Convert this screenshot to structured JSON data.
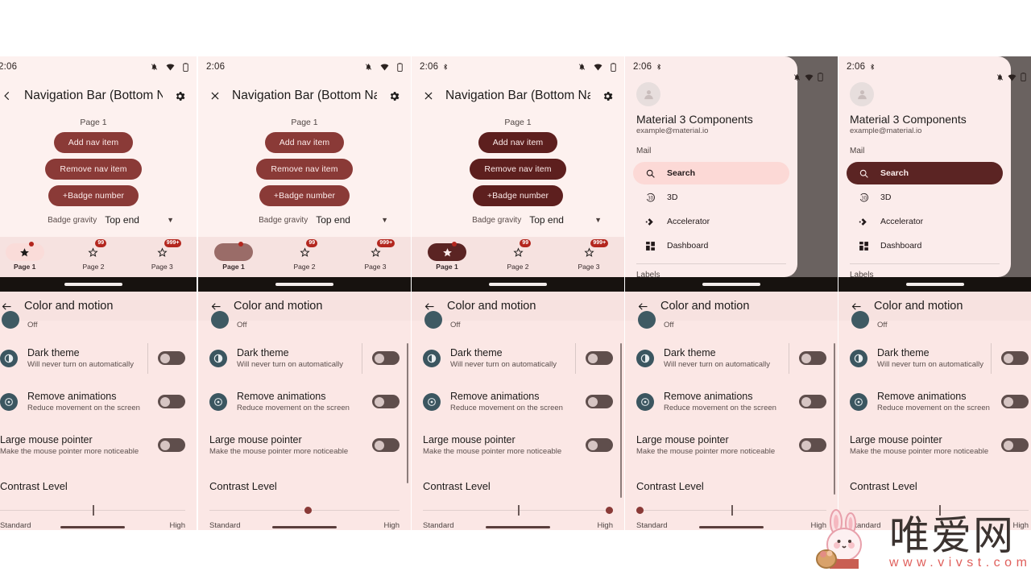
{
  "statusbar": {
    "time": "2:06",
    "time_clipped": "06",
    "icons": [
      "notifications-off-icon",
      "wifi-icon",
      "battery-icon",
      "bluetooth-icon"
    ]
  },
  "demo": {
    "title": "Navigation Bar (Bottom Naviga...",
    "page_label": "Page 1",
    "buttons": [
      {
        "label": "Add nav item"
      },
      {
        "label": "Remove nav item"
      },
      {
        "label": "+Badge number"
      }
    ],
    "gravity_label": "Badge gravity",
    "gravity_value": "Top end",
    "nav_items": [
      {
        "label": "Page 1",
        "badge": "",
        "badge_dot": true
      },
      {
        "label": "Page 2",
        "badge": "99",
        "badge_dot": false
      },
      {
        "label": "Page 3",
        "badge": "999+",
        "badge_dot": false
      }
    ]
  },
  "drawer": {
    "title": "Material 3 Components",
    "email": "example@material.io",
    "section_mail": "Mail",
    "section_labels": "Labels",
    "items": [
      {
        "label": "Search",
        "icon": "search-icon"
      },
      {
        "label": "3D",
        "icon": "threed-icon"
      },
      {
        "label": "Accelerator",
        "icon": "accelerator-icon"
      },
      {
        "label": "Dashboard",
        "icon": "dashboard-icon"
      }
    ]
  },
  "settings": {
    "title": "Color and motion",
    "partial_row_value": "Off",
    "rows": [
      {
        "title": "Dark theme",
        "desc": "Will never turn on automatically",
        "icon": "contrast-icon"
      },
      {
        "title": "Remove animations",
        "desc": "Reduce movement on the screen",
        "icon": "motion-icon"
      },
      {
        "title": "Large mouse pointer",
        "desc": "Make the mouse pointer more noticeable",
        "icon": ""
      }
    ],
    "slider_title": "Contrast Level",
    "slider_min_label": "Standard",
    "slider_max_label": "High",
    "slider_positions": [
      "middle",
      "middle-thumb",
      "high",
      "standard",
      "middle"
    ]
  },
  "watermark": {
    "cn": "唯爱网",
    "url": "www.vivst.com"
  },
  "colors": {
    "accent": "#8a3a37",
    "accent_dark": "#5d1f1e",
    "surface": "#fdf1ef",
    "surface_settings": "#fbe7e5",
    "badge": "#b3261e",
    "scrim": "#6a6260"
  }
}
